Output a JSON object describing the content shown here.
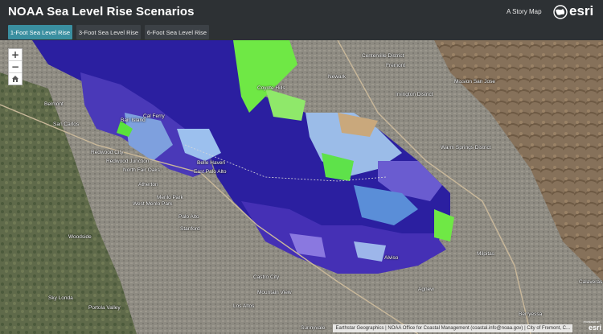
{
  "header": {
    "title": "NOAA Sea Level Rise Scenarios",
    "story_map_link": "A Story Map",
    "logo_text": "esri"
  },
  "tabs": [
    {
      "label": "1-Foot Sea Level Rise",
      "active": true
    },
    {
      "label": "3-Foot Sea Level Rise",
      "active": false
    },
    {
      "label": "6-Foot Sea Level Rise",
      "active": false
    }
  ],
  "map": {
    "zoom_in": "+",
    "zoom_out": "−",
    "home_icon": "home-icon",
    "labels": [
      "Newark",
      "Centerville District",
      "Fremont",
      "Irvington District",
      "Mission San Jose",
      "Warm Springs District",
      "Belmont",
      "San Carlos",
      "Redwood City",
      "Redwood Junction",
      "North Fair Oaks",
      "Belle Haven",
      "East Palo Alto",
      "Menlo Park",
      "Atherton",
      "West Menlo Park",
      "Palo Alto",
      "Stanford",
      "Woodside",
      "Sky Londa",
      "Portola Valley",
      "Los Altos",
      "Mountain View",
      "Sunnyvale",
      "Milpitas",
      "Agnew",
      "Alviso",
      "Berryessa",
      "Calaveras",
      "Coyote Hills",
      "Bair Island",
      "Cal Ferry",
      "Castro City"
    ],
    "attribution": "Earthstar Geographics | NOAA Office for Coastal Management (coastal.info@noaa.gov) | City of Fremont, C...",
    "powered_by": "esri",
    "colors": {
      "bay_water": "#2b1fa0",
      "flood_light": "#8fb8e8",
      "flood_green": "#6fe845",
      "land_urban": "#8d8a80",
      "land_hills": "#8a7558"
    }
  }
}
